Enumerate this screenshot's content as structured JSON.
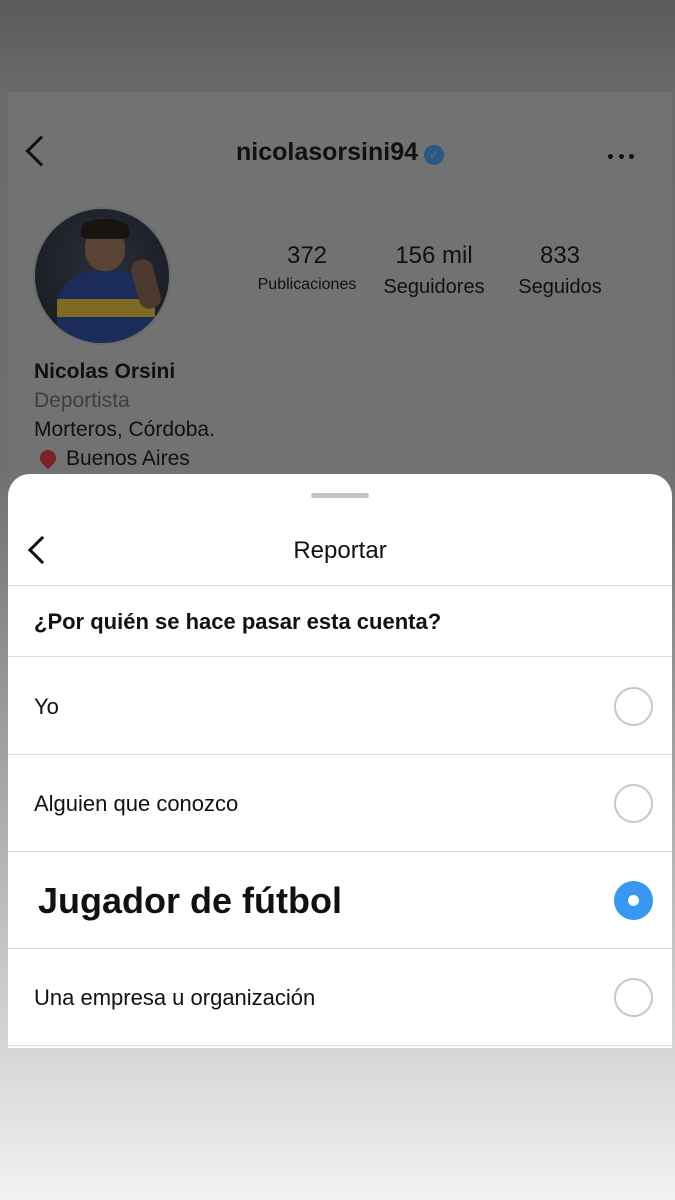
{
  "profile": {
    "username": "nicolasorsini94",
    "verified_icon": "verified-badge-icon",
    "name": "Nicolas Orsini",
    "category": "Deportista",
    "bio_line1": "Morteros, Córdoba.",
    "location": "Buenos Aires",
    "stats": {
      "posts_count": "372",
      "posts_label": "Publicaciones",
      "followers_count": "156 mil",
      "followers_label": "Seguidores",
      "following_count": "833",
      "following_label": "Seguidos"
    }
  },
  "sheet": {
    "title": "Reportar",
    "question": "¿Por quién se hace pasar esta cuenta?",
    "options": [
      {
        "label": "Yo",
        "selected": false
      },
      {
        "label": "Alguien que conozco",
        "selected": false
      },
      {
        "label": "Jugador de fútbol",
        "selected": true
      },
      {
        "label": "Una empresa u organización",
        "selected": false
      }
    ],
    "accent_color": "#3897f0"
  }
}
